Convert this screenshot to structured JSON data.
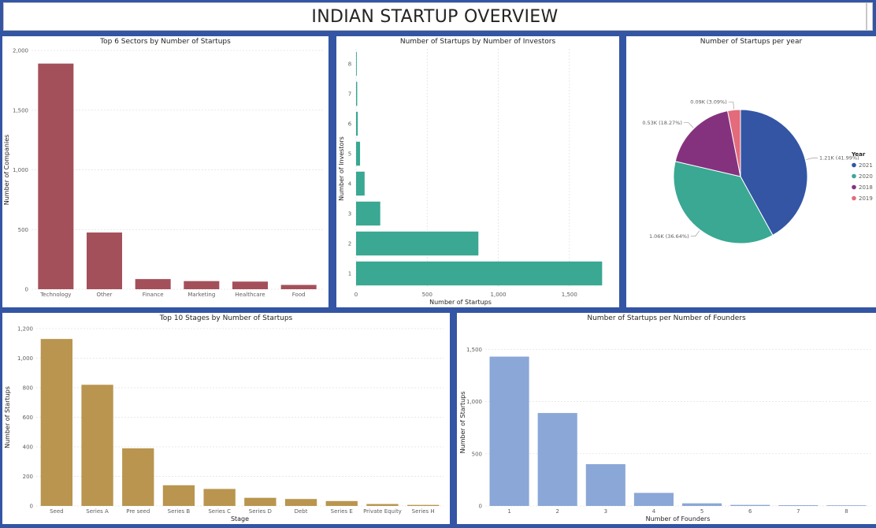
{
  "dashboard": {
    "title": "INDIAN STARTUP OVERVIEW"
  },
  "chart_data": [
    {
      "id": "sectors",
      "type": "bar",
      "title": "Top 6 Sectors by Number of Startups",
      "xlabel": "",
      "ylabel": "Number of Companies",
      "color": "#a4505a",
      "categories": [
        "Technology",
        "Other",
        "Finance",
        "Marketing",
        "Healthcare",
        "Food"
      ],
      "values": [
        1890,
        475,
        85,
        68,
        64,
        36
      ],
      "ylim": [
        0,
        2000
      ],
      "yticks": [
        0,
        500,
        1000,
        1500,
        2000
      ],
      "ytick_labels": [
        "0",
        "500",
        "1,000",
        "1,500",
        "2,000"
      ],
      "grid": true
    },
    {
      "id": "investors",
      "type": "bar",
      "orientation": "horizontal",
      "title": "Number of Startups by Number of Investors",
      "xlabel": "Number of Startups",
      "ylabel": "Number of Investors",
      "color": "#3aa893",
      "categories": [
        "1",
        "2",
        "3",
        "4",
        "5",
        "6",
        "7",
        "8"
      ],
      "values": [
        1730,
        860,
        170,
        60,
        28,
        12,
        8,
        5
      ],
      "xlim": [
        0,
        1800
      ],
      "xticks": [
        0,
        500,
        1000,
        1500
      ],
      "xtick_labels": [
        "0",
        "500",
        "1,000",
        "1,500"
      ],
      "grid": true
    },
    {
      "id": "years",
      "type": "pie",
      "title": "Number of Startups per year",
      "legend_title": "Year",
      "legend_position": "right",
      "slices": [
        {
          "label": "2021",
          "value": 41.99,
          "display": "1.21K (41.99%)",
          "color": "#3355a4"
        },
        {
          "label": "2020",
          "value": 36.64,
          "display": "1.06K (36.64%)",
          "color": "#3aa893"
        },
        {
          "label": "2018",
          "value": 18.27,
          "display": "0.53K (18.27%)",
          "color": "#85327e"
        },
        {
          "label": "2019",
          "value": 3.09,
          "display": "0.09K (3.09%)",
          "color": "#e36b7b"
        }
      ]
    },
    {
      "id": "stages",
      "type": "bar",
      "title": "Top 10 Stages by Number of Startups",
      "xlabel": "Stage",
      "ylabel": "Number of Startups",
      "color": "#b9954f",
      "categories": [
        "Seed",
        "Series A",
        "Pre seed",
        "Series B",
        "Series C",
        "Series D",
        "Debt",
        "Series E",
        "Private Equity",
        "Series H"
      ],
      "values": [
        1130,
        820,
        390,
        140,
        115,
        55,
        47,
        33,
        13,
        7
      ],
      "ylim": [
        0,
        1200
      ],
      "yticks": [
        0,
        200,
        400,
        600,
        800,
        1000,
        1200
      ],
      "ytick_labels": [
        "0",
        "200",
        "400",
        "600",
        "800",
        "1,000",
        "1,200"
      ],
      "grid": true
    },
    {
      "id": "founders",
      "type": "bar",
      "title": "Number of Startups per Number of Founders",
      "xlabel": "Number of Founders",
      "ylabel": "Number of Startups",
      "color": "#8ba7d7",
      "categories": [
        "1",
        "2",
        "3",
        "4",
        "5",
        "6",
        "7",
        "8"
      ],
      "values": [
        1430,
        890,
        400,
        125,
        25,
        10,
        7,
        6
      ],
      "ylim": [
        0,
        1600
      ],
      "yticks": [
        0,
        500,
        1000,
        1500
      ],
      "ytick_labels": [
        "0",
        "500",
        "1,000",
        "1,500"
      ],
      "grid": true
    }
  ]
}
